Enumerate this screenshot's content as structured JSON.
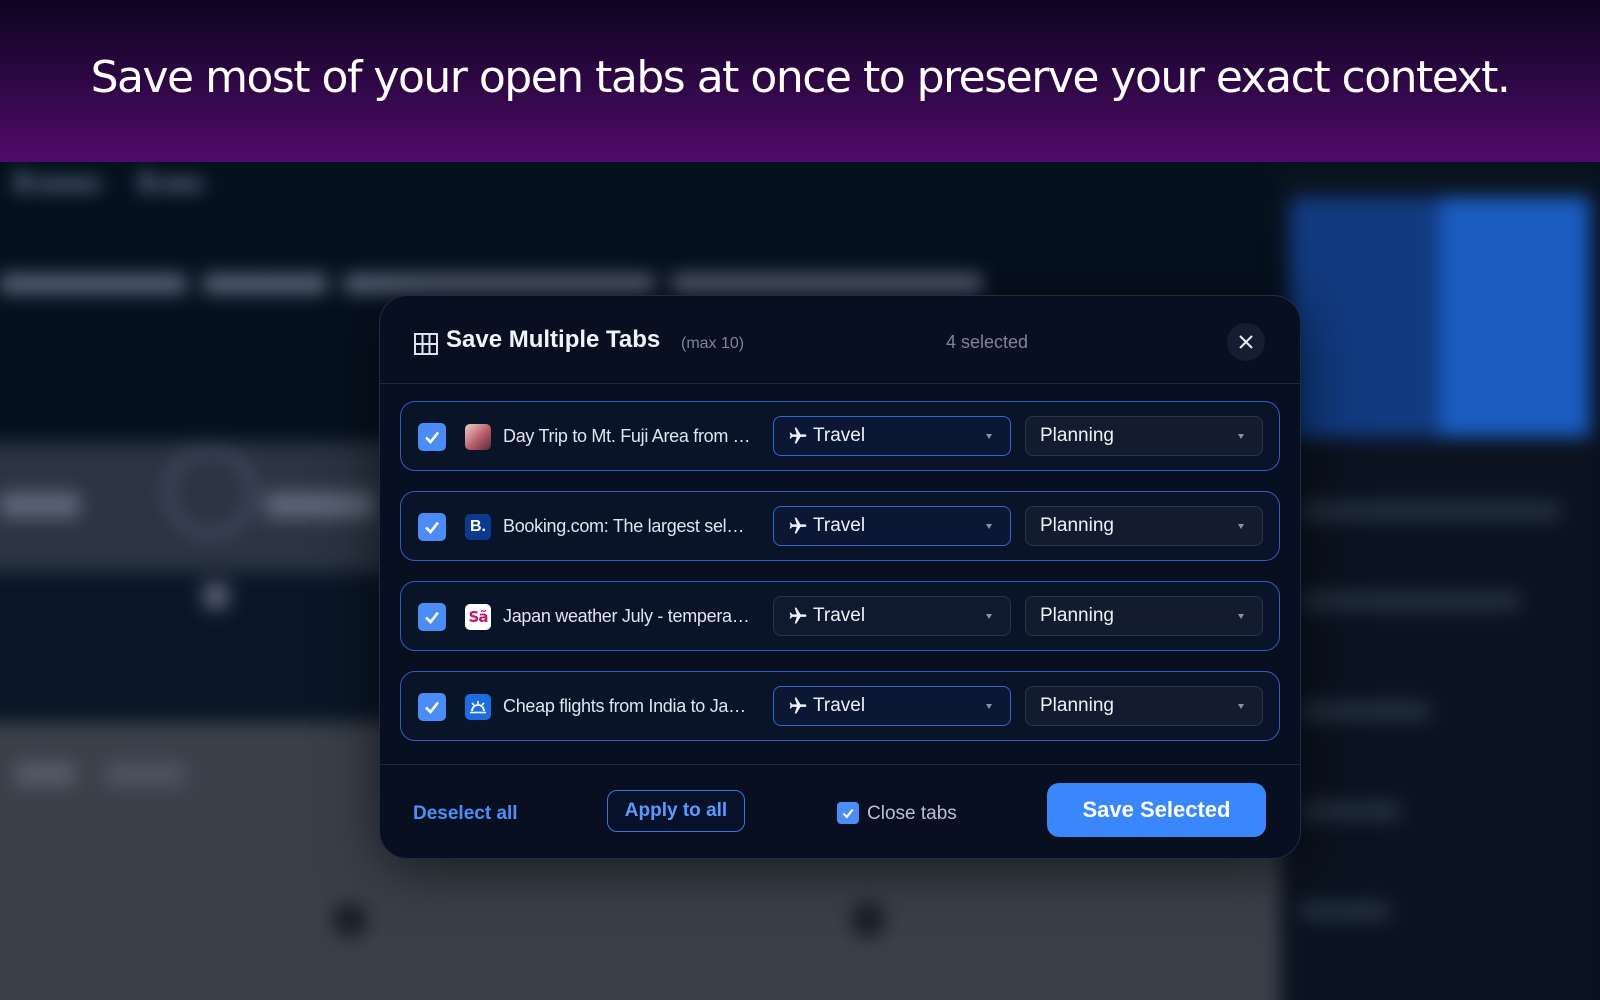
{
  "banner": {
    "headline": "Save most of your open tabs at once to preserve your exact context."
  },
  "modal": {
    "title": "Save Multiple Tabs",
    "max_note": "(max 10)",
    "selected_count": "4 selected",
    "close_icon": "close-icon",
    "tabs": [
      {
        "checked": true,
        "favicon": "mt-fuji-tour-favicon",
        "title": "Day Trip to Mt. Fuji Area from Tokyo",
        "category": "Travel",
        "subcategory": "Planning"
      },
      {
        "checked": true,
        "favicon": "booking-favicon",
        "favicon_text": "B.",
        "title": "Booking.com: The largest selection of hotels",
        "category": "Travel",
        "subcategory": "Planning"
      },
      {
        "checked": true,
        "favicon": "weather-favicon",
        "favicon_text": "Sã",
        "title": "Japan weather July - temperature",
        "category": "Travel",
        "subcategory": "Planning"
      },
      {
        "checked": true,
        "favicon": "skyscanner-favicon",
        "title": "Cheap flights from India to Japan",
        "category": "Travel",
        "subcategory": "Planning"
      }
    ],
    "footer": {
      "deselect_label": "Deselect all",
      "apply_label": "Apply to all",
      "close_tabs_checked": true,
      "close_tabs_label": "Close tabs",
      "save_label": "Save Selected"
    }
  },
  "colors": {
    "accent": "#3a86fb",
    "modal_bg": "#080f21",
    "row_border": "#2d5ec0",
    "banner_top": "#0d0420",
    "banner_bottom": "#520a6a"
  }
}
